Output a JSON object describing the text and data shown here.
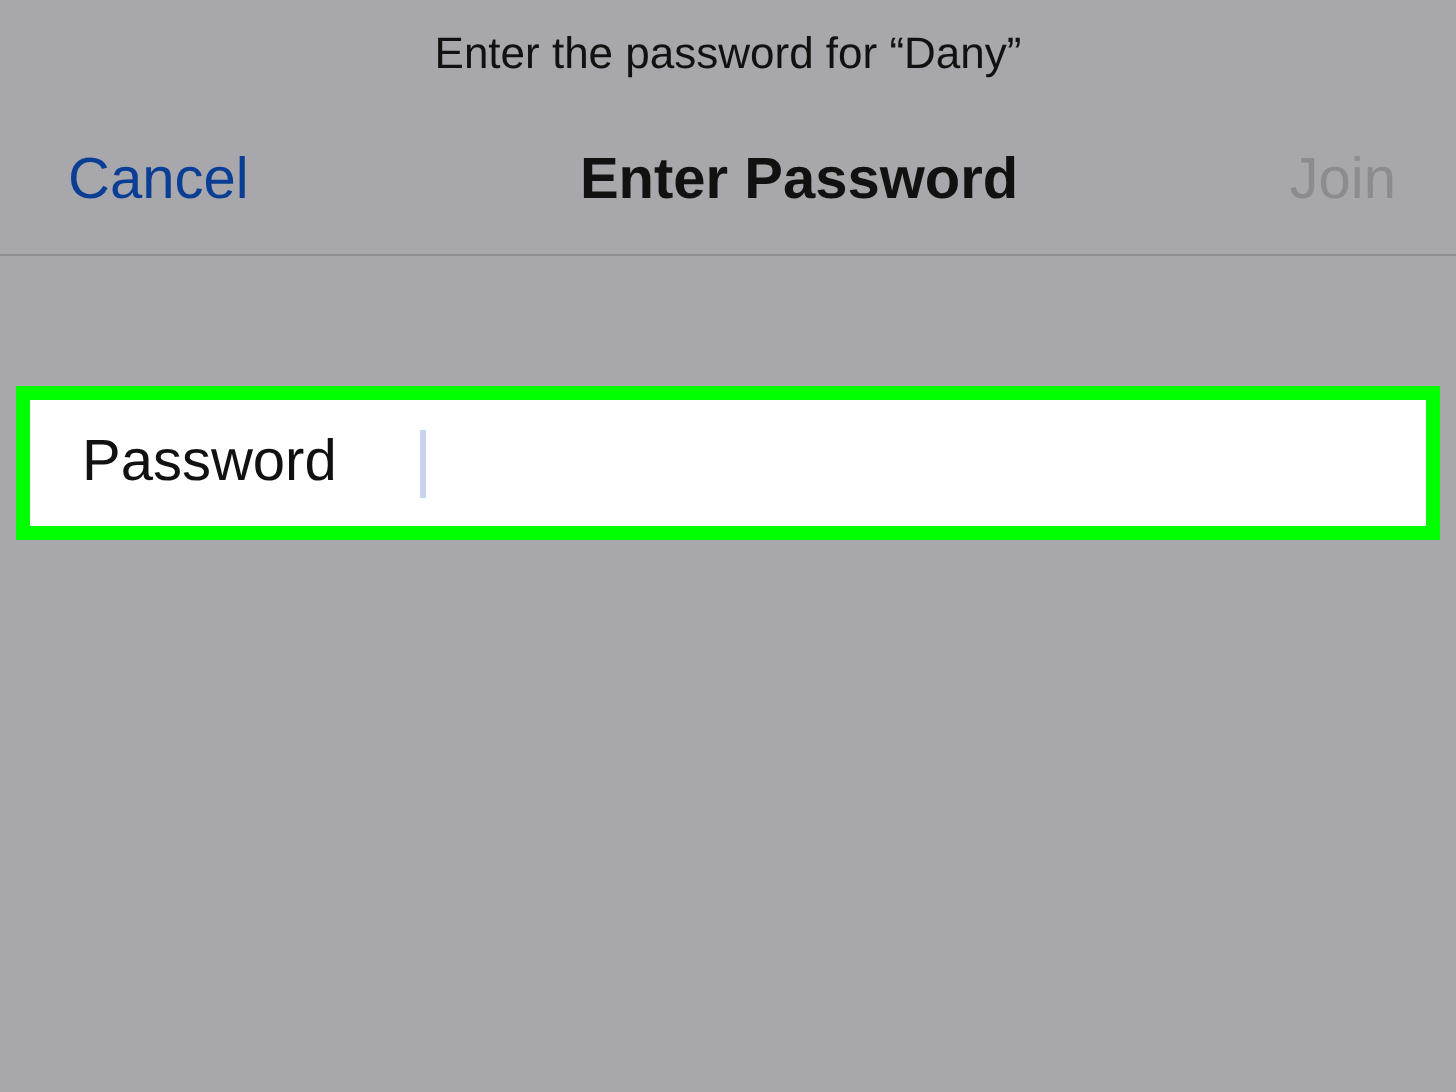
{
  "prompt": "Enter the password for “Dany”",
  "nav_bar": {
    "cancel": "Cancel",
    "title": "Enter Password",
    "join": {
      "label": "Join",
      "disabled": true
    }
  },
  "password_field": {
    "label": "Password",
    "highlighted": true,
    "focused": true
  }
}
